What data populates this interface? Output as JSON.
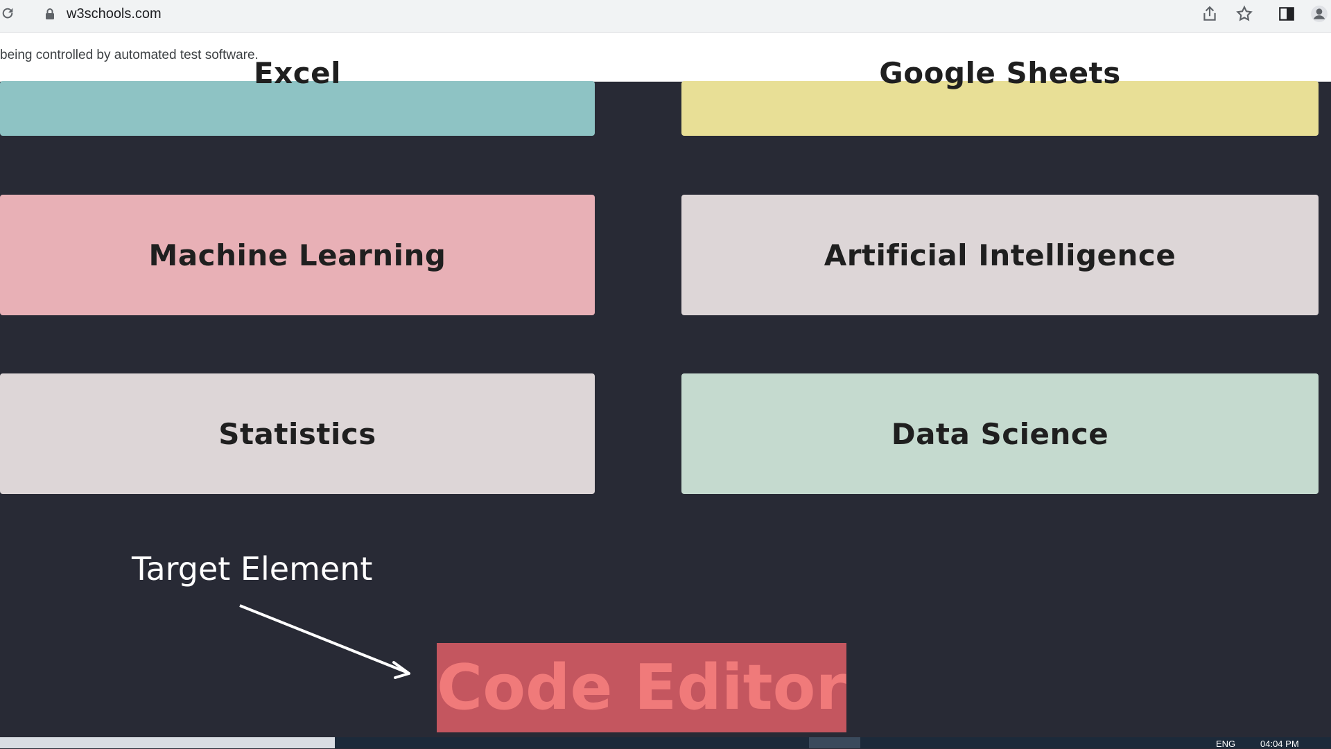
{
  "browser": {
    "url": "w3schools.com",
    "icons": [
      "reload-icon",
      "lock-icon",
      "share-icon",
      "star-icon",
      "side-panel-icon",
      "profile-icon"
    ]
  },
  "infobar": {
    "message": "being controlled by automated test software."
  },
  "tiles": [
    {
      "label": "Excel",
      "color": "#8ec3c4"
    },
    {
      "label": "Google Sheets",
      "color": "#e8df96"
    },
    {
      "label": "Machine Learning",
      "color": "#e8b0b6"
    },
    {
      "label": "Artificial Intelligence",
      "color": "#ddd6d7"
    },
    {
      "label": "Statistics",
      "color": "#ddd6d7"
    },
    {
      "label": "Data Science",
      "color": "#c5dacf"
    }
  ],
  "annotation": {
    "label": "Target Element"
  },
  "highlight": {
    "label": "Code Editor",
    "color": "#c4565f"
  },
  "taskbar": {
    "lang": "ENG",
    "time": "04:04 PM"
  },
  "colors": {
    "page_background": "#282a35"
  }
}
